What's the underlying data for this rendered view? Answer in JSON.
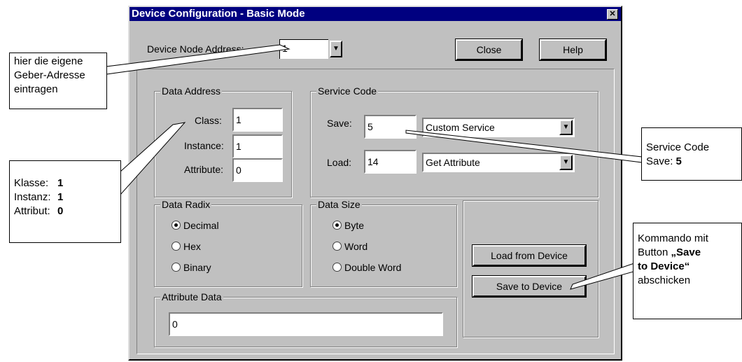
{
  "window": {
    "title": "Device Configuration - Basic Mode",
    "close_glyph": "✕",
    "node_address_label": "Device Node Address:",
    "node_address_value": "1",
    "close_button": "Close",
    "help_button": "Help"
  },
  "data_address": {
    "title": "Data Address",
    "class_label": "Class:",
    "class_value": "1",
    "instance_label": "Instance:",
    "instance_value": "1",
    "attribute_label": "Attribute:",
    "attribute_value": "0"
  },
  "service_code": {
    "title": "Service Code",
    "save_label": "Save:",
    "save_value": "5",
    "save_service": "Custom Service",
    "load_label": "Load:",
    "load_value": "14",
    "load_service": "Get Attribute"
  },
  "data_radix": {
    "title": "Data Radix",
    "options": [
      "Decimal",
      "Hex",
      "Binary"
    ],
    "selected": "Decimal"
  },
  "data_size": {
    "title": "Data Size",
    "options": [
      "Byte",
      "Word",
      "Double Word"
    ],
    "selected": "Byte"
  },
  "buttons": {
    "load_from_device": "Load from Device",
    "save_to_device": "Save to Device"
  },
  "attribute_data": {
    "title": "Attribute Data",
    "value": "0"
  },
  "annotations": {
    "geber_adresse": [
      "hier die eigene",
      "Geber-Adresse",
      "eintragen"
    ],
    "klasse_label": "Klasse:",
    "klasse_value": "1",
    "instanz_label": "Instanz:",
    "instanz_value": "1",
    "attribut_label": "Attribut:",
    "attribut_value": "0",
    "service_code_line1": "Service Code",
    "service_code_label": "Save:",
    "service_code_value": "5",
    "kommando": [
      "Kommando mit",
      "Button ",
      "„Save",
      "to Device“",
      "abschicken"
    ]
  }
}
